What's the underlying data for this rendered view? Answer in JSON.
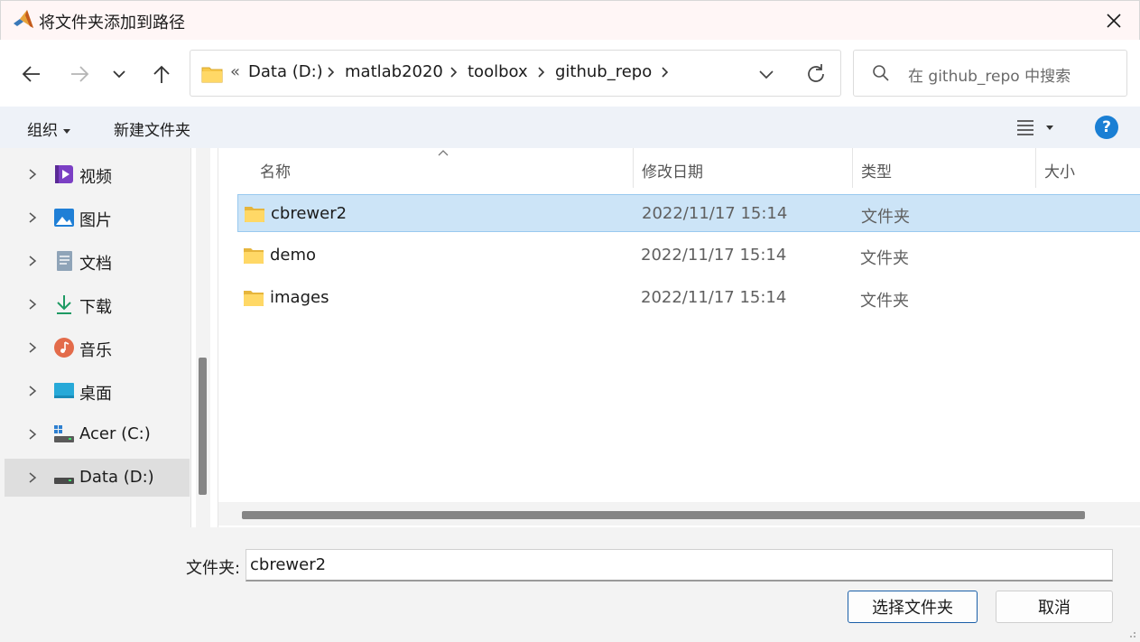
{
  "window": {
    "title": "将文件夹添加到路径",
    "app_icon": "matlab-icon"
  },
  "nav": {
    "back_icon": "arrow-left-icon",
    "forward_icon": "arrow-right-icon",
    "recent_icon": "chevron-down-icon",
    "up_icon": "arrow-up-icon"
  },
  "address": {
    "overflow": "«",
    "crumbs": [
      "Data (D:)",
      "matlab2020",
      "toolbox",
      "github_repo"
    ]
  },
  "search": {
    "placeholder": "在 github_repo 中搜索"
  },
  "toolbar": {
    "organize": "组织",
    "new_folder": "新建文件夹",
    "help": "?"
  },
  "sidebar": {
    "items": [
      {
        "label": "视频",
        "icon": "video-icon"
      },
      {
        "label": "图片",
        "icon": "pictures-icon"
      },
      {
        "label": "文档",
        "icon": "document-icon"
      },
      {
        "label": "下载",
        "icon": "download-icon"
      },
      {
        "label": "音乐",
        "icon": "music-icon"
      },
      {
        "label": "桌面",
        "icon": "desktop-icon"
      },
      {
        "label": "Acer (C:)",
        "icon": "drive-c-icon"
      },
      {
        "label": "Data (D:)",
        "icon": "drive-d-icon"
      }
    ],
    "selected_index": 7
  },
  "columns": [
    "名称",
    "修改日期",
    "类型",
    "大小"
  ],
  "files": [
    {
      "name": "cbrewer2",
      "date": "2022/11/17 15:14",
      "type": "文件夹",
      "selected": true
    },
    {
      "name": "demo",
      "date": "2022/11/17 15:14",
      "type": "文件夹",
      "selected": false
    },
    {
      "name": "images",
      "date": "2022/11/17 15:14",
      "type": "文件夹",
      "selected": false
    }
  ],
  "footer": {
    "folder_label": "文件夹:",
    "folder_value": "cbrewer2",
    "select_button": "选择文件夹",
    "cancel_button": "取消"
  },
  "colors": {
    "accent": "#1a7fd4",
    "selection": "#cce4f7",
    "folder": "#f8c94a"
  }
}
